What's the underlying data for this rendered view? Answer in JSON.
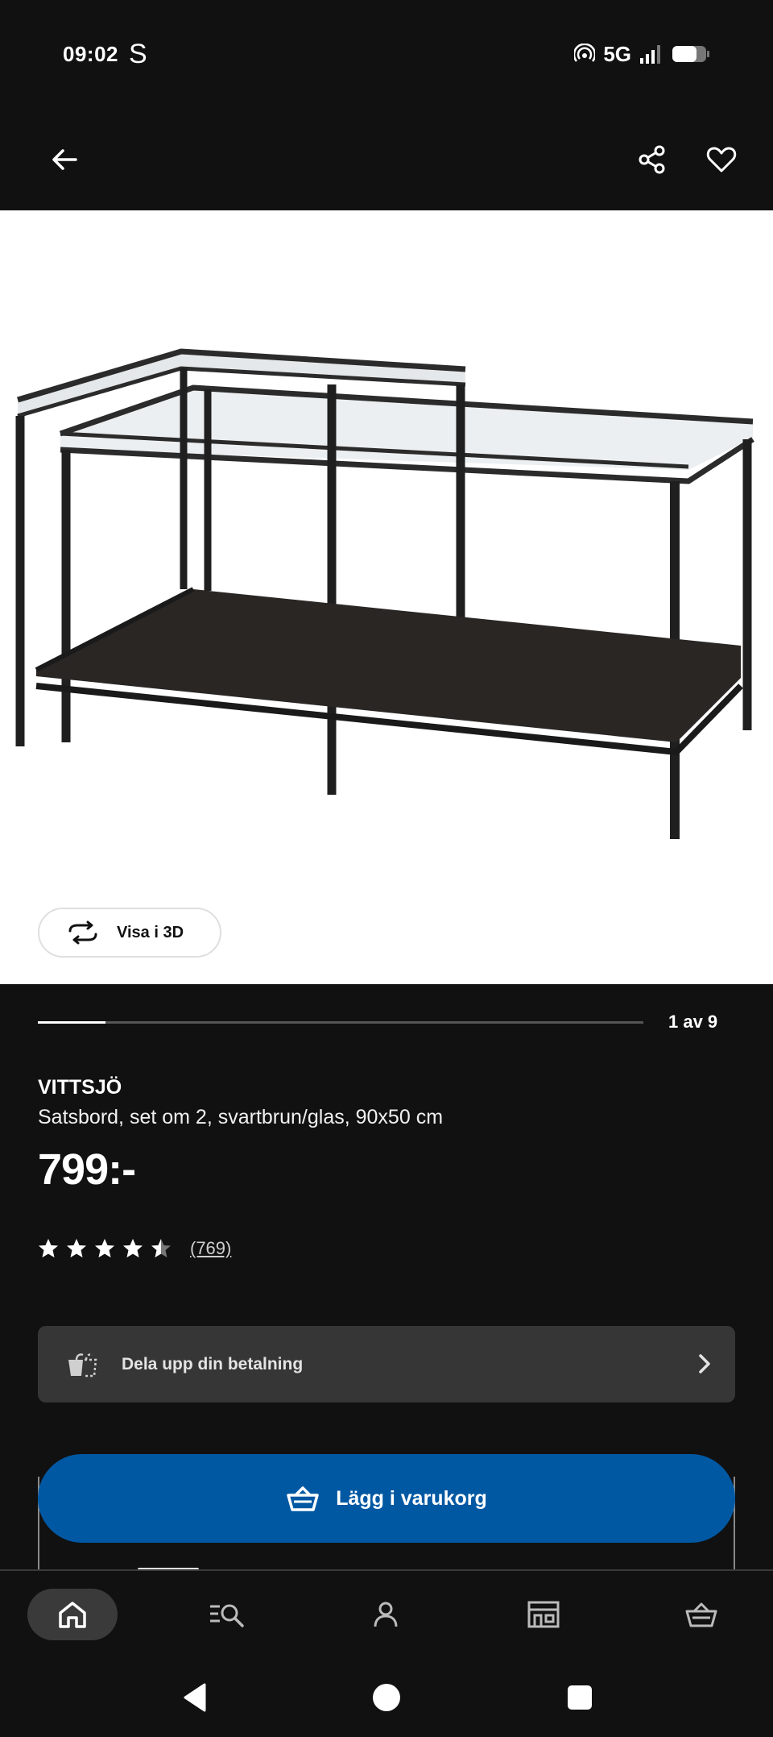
{
  "status_bar": {
    "time": "09:02",
    "carrier_glyph": "S",
    "network": "5G",
    "icons": [
      "hotspot-icon",
      "signal-icon",
      "battery-icon"
    ]
  },
  "app_bar": {
    "icons": [
      "back-arrow-icon",
      "share-icon",
      "heart-icon"
    ]
  },
  "gallery": {
    "view_3d_label": "Visa i 3D",
    "counter": "1 av 9",
    "current_index": 1,
    "total": 9
  },
  "product": {
    "name": "VITTSJÖ",
    "description": "Satsbord, set om 2, svartbrun/glas, 90x50 cm",
    "price": "799:-",
    "rating": 4.5,
    "review_count": "(769)"
  },
  "installment": {
    "label": "Dela upp din betalning"
  },
  "cart_button": {
    "label": "Lägg i varukorg"
  },
  "bottom_nav": {
    "items": [
      "home-icon",
      "search-list-icon",
      "profile-icon",
      "store-icon",
      "cart-icon"
    ],
    "active": "home-icon"
  },
  "colors": {
    "background": "#111111",
    "accent_blue": "#0058a3",
    "card_gray": "#363636"
  }
}
